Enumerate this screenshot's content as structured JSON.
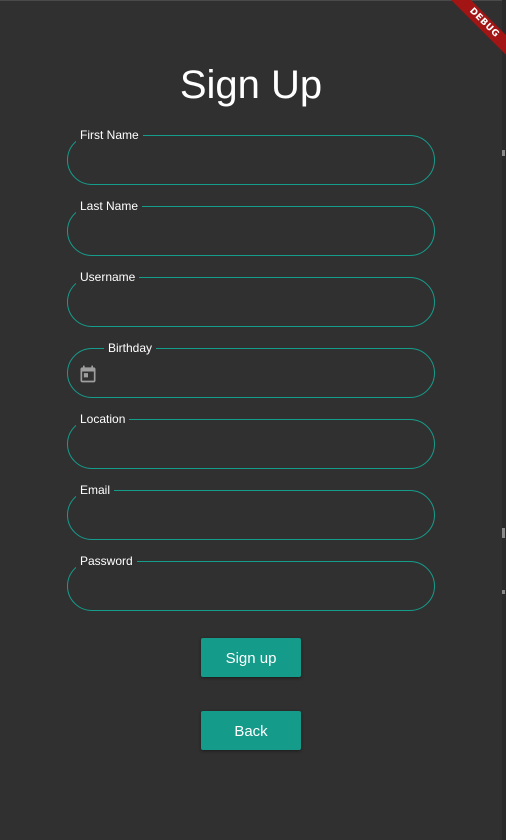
{
  "debug_banner": "DEBUG",
  "page_title": "Sign Up",
  "form": {
    "fields": [
      {
        "label": "First Name",
        "value": ""
      },
      {
        "label": "Last Name",
        "value": ""
      },
      {
        "label": "Username",
        "value": ""
      },
      {
        "label": "Birthday",
        "value": "",
        "icon": "calendar-icon"
      },
      {
        "label": "Location",
        "value": ""
      },
      {
        "label": "Email",
        "value": ""
      },
      {
        "label": "Password",
        "value": ""
      }
    ]
  },
  "buttons": {
    "signup_label": "Sign up",
    "back_label": "Back"
  },
  "colors": {
    "background": "#303030",
    "accent": "#159b8a",
    "field_border": "#159d8c",
    "text": "#ffffff",
    "icon": "#9e9e9e",
    "debug_banner": "#a31515"
  }
}
